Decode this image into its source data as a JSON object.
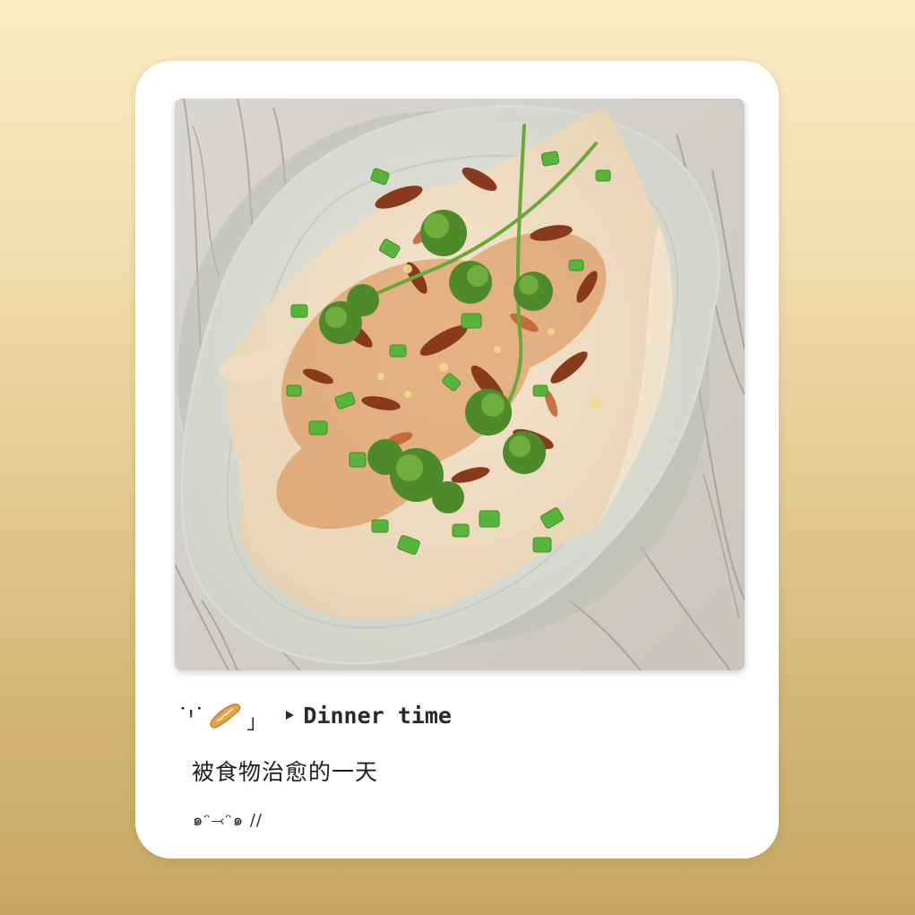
{
  "caption": {
    "bracket_open": "˙ᵎ˙",
    "bracket_close": "」",
    "headline": "Dinner time"
  },
  "subtitle": "被食物治愈的一天",
  "kaomoji": "๑ᵔ⤙ᵔ๑ //",
  "icons": {
    "bread": "baguette-icon",
    "arrow": "play-icon"
  },
  "photo": {
    "subject": "steamed fish with cilantro, scallions and fried shallots on a scalloped white plate"
  },
  "colors": {
    "background_top": "#fbecc4",
    "background_bottom": "#c4a862",
    "card": "#ffffff",
    "text": "#2a2a2a"
  }
}
